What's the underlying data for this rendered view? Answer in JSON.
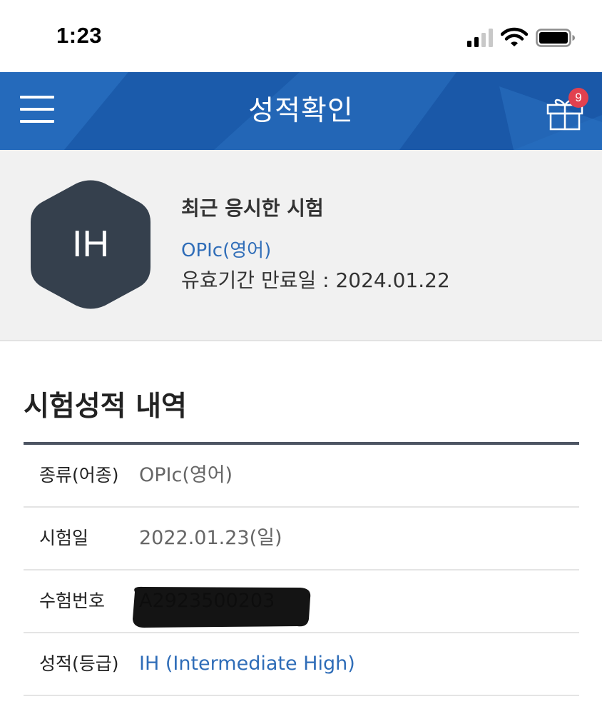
{
  "status_bar": {
    "time": "1:23"
  },
  "header": {
    "title": "성적확인",
    "gift_badge": "9"
  },
  "recent_exam": {
    "grade": "IH",
    "heading": "최근 응시한 시험",
    "exam_name": "OPIc(영어)",
    "expiry": "유효기간 만료일 : 2024.01.22"
  },
  "results": {
    "title": "시험성적 내역",
    "rows": [
      {
        "label": "종류(어종)",
        "value": "OPIc(영어)"
      },
      {
        "label": "시험일",
        "value": "2022.01.23(일)"
      },
      {
        "label": "수험번호",
        "value": "A2923500203"
      },
      {
        "label": "성적(등급)",
        "value": "IH (Intermediate High)"
      }
    ]
  },
  "colors": {
    "header_blue": "#1f63b4",
    "link_blue": "#2f6db8",
    "hex_dark": "#35404d",
    "badge_red": "#e2414f"
  }
}
